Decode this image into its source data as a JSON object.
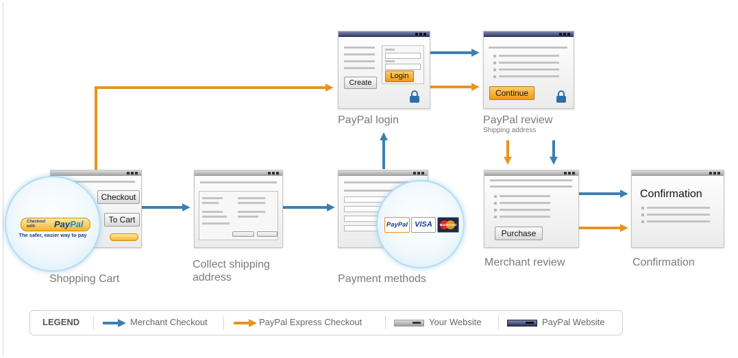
{
  "nodes": {
    "cart": {
      "label": "Shopping Cart",
      "checkout_button": "Checkout",
      "add_to_cart_button": "To Cart",
      "paypal_logo": "Checkout with PayPal",
      "paypal_tagline": "The safer, easier way to pay"
    },
    "shipping": {
      "label_line1": "Collect shipping",
      "label_line2": "address"
    },
    "payment": {
      "label": "Payment methods",
      "cards": [
        "PayPal",
        "VISA",
        "MasterCard"
      ]
    },
    "login": {
      "label": "PayPal login",
      "create_button": "Create",
      "login_button": "Login"
    },
    "review": {
      "label": "PayPal review",
      "sublabel": "Shipping address",
      "continue_button": "Continue"
    },
    "merchant_review": {
      "label": "Merchant review",
      "purchase_button": "Purchase"
    },
    "confirmation": {
      "label": "Confirmation",
      "window_heading": "Confirmation"
    }
  },
  "legend": {
    "title": "LEGEND",
    "merchant_checkout": "Merchant Checkout",
    "paypal_express": "PayPal Express Checkout",
    "your_website": "Your Website",
    "paypal_website": "PayPal Website"
  },
  "colors": {
    "merchant_flow": "#3d7fb0",
    "paypal_flow": "#e8941f",
    "paypal_titlebar": "#2f3868",
    "site_titlebar": "#9c9c9c"
  }
}
